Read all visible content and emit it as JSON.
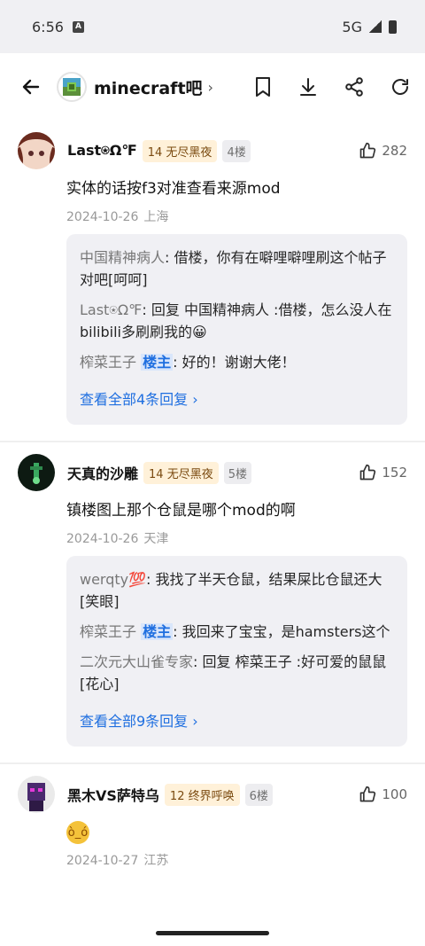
{
  "status": {
    "time": "6:56",
    "network": "5G"
  },
  "nav": {
    "forum_name": "minecraft吧"
  },
  "comments": [
    {
      "username": "Last⍟Ω℉",
      "level": "14 无尽黑夜",
      "floor": "4楼",
      "likes": "282",
      "text": "实体的话按f3对准查看来源mod",
      "date": "2024-10-26",
      "location": "上海",
      "replies": [
        {
          "user": "中国精神病人",
          "sep": ": ",
          "text": "借楼，你有在噼哩噼哩刷这个帖子对吧[呵呵]"
        },
        {
          "user": "Last⍟Ω℉",
          "sep": ": ",
          "text": "回复 中国精神病人 :借楼，怎么没人在bilibili多刷刷我的😀"
        },
        {
          "user": "榨菜王子",
          "host": "楼主",
          "sep": ": ",
          "text": "好的！谢谢大佬！"
        }
      ],
      "more": "查看全部4条回复"
    },
    {
      "username": "天真的沙雕",
      "level": "14 无尽黑夜",
      "floor": "5楼",
      "likes": "152",
      "text": "镇楼图上那个仓鼠是哪个mod的啊",
      "date": "2024-10-26",
      "location": "天津",
      "replies": [
        {
          "user": "werqty💯",
          "sep": ": ",
          "text": "我找了半天仓鼠，结果屎比仓鼠还大[笑眼]"
        },
        {
          "user": "榨菜王子",
          "host": "楼主",
          "sep": ": ",
          "text": "我回来了宝宝，是hamsters这个"
        },
        {
          "user": "二次元大山雀专家",
          "sep": ": ",
          "text": "回复 榨菜王子 :好可爱的鼠鼠[花心]"
        }
      ],
      "more": "查看全部9条回复"
    },
    {
      "username": "黑木VS萨特乌",
      "level": "12 终界呼唤",
      "floor": "6楼",
      "likes": "100",
      "date": "2024-10-27",
      "location": "江苏"
    }
  ],
  "colors": {
    "accent": "#1f6fe0",
    "level_bg": "#fff1d9",
    "reply_bg": "#f0f0f4"
  }
}
